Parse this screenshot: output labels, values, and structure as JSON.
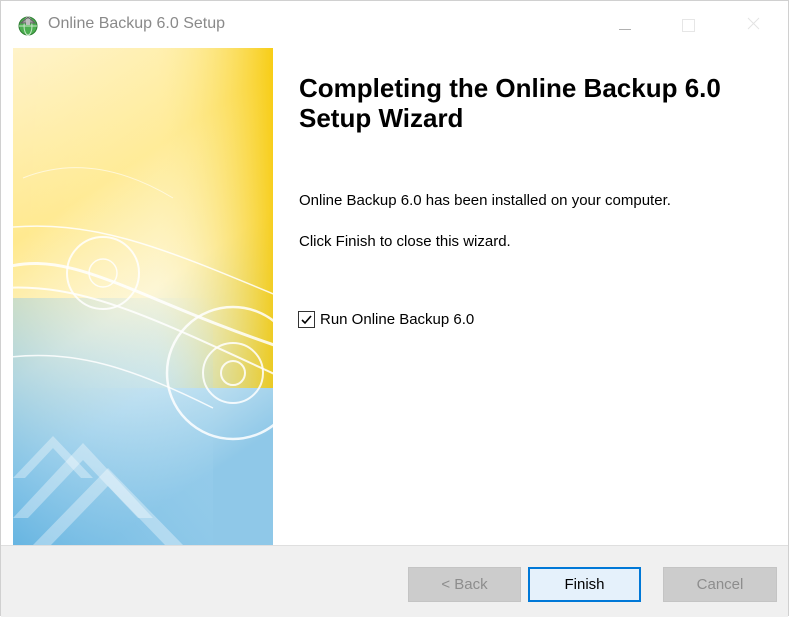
{
  "window": {
    "title": "Online Backup 6.0 Setup",
    "icon": "backup-globe-icon"
  },
  "titlebar_buttons": {
    "minimize_icon": "minimize-icon",
    "maximize_icon": "maximize-icon",
    "close_icon": "close-icon"
  },
  "content": {
    "heading": "Completing the Online Backup 6.0 Setup Wizard",
    "installed_text": "Online Backup 6.0 has been installed on your computer.",
    "finish_hint": "Click Finish to close this wizard.",
    "run_checkbox": {
      "label": "Run Online Backup 6.0",
      "checked": true
    }
  },
  "footer": {
    "back_label": "< Back",
    "finish_label": "Finish",
    "cancel_label": "Cancel"
  },
  "colors": {
    "accent": "#0078d7",
    "disabled_button_bg": "#cccccc",
    "footer_bg": "#f0f0f0"
  }
}
